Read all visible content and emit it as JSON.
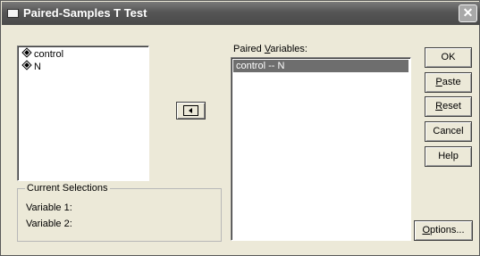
{
  "window": {
    "title": "Paired-Samples T Test"
  },
  "variables": [
    {
      "name": "control"
    },
    {
      "name": "N"
    }
  ],
  "paired": {
    "label_pre": "Paired ",
    "label_underlined": "V",
    "label_post": "ariables:",
    "rows": [
      "control -- N"
    ]
  },
  "current_selections": {
    "title": "Current Selections",
    "variable1": "Variable 1:",
    "variable2": "Variable 2:"
  },
  "buttons": {
    "ok": "OK",
    "paste_ul": "P",
    "paste_rest": "aste",
    "reset_ul": "R",
    "reset_rest": "eset",
    "cancel": "Cancel",
    "help": "Help",
    "options_ul": "O",
    "options_rest": "ptions..."
  },
  "icons": {
    "close": "close-icon",
    "variable": "scale-variable-icon",
    "move": "move-left-arrow-icon"
  }
}
